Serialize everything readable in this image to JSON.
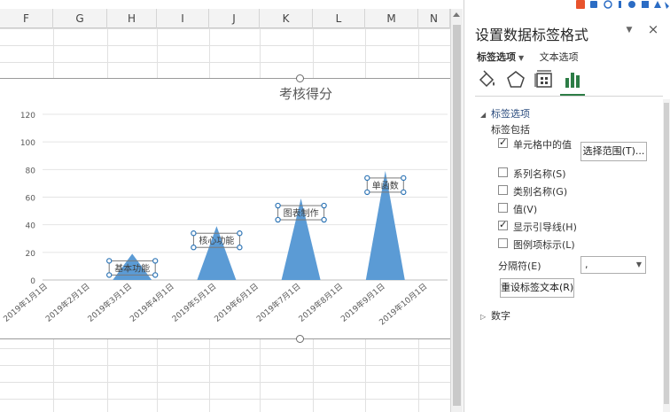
{
  "sheet": {
    "columns": [
      "F",
      "G",
      "H",
      "I",
      "J",
      "K",
      "L",
      "M",
      "N"
    ]
  },
  "chart": {
    "title": "考核得分"
  },
  "chart_data": {
    "type": "bar",
    "shape": "triangle",
    "title": "考核得分",
    "xlabel": "",
    "ylabel": "",
    "ylim": [
      0,
      120
    ],
    "yticks": [
      0,
      20,
      40,
      60,
      80,
      100,
      120
    ],
    "grid": true,
    "color": "#5b9bd5",
    "categories": [
      "2019年1月1日",
      "2019年2月1日",
      "2019年3月1日",
      "2019年4月1日",
      "2019年5月1日",
      "2019年6月1日",
      "2019年7月1日",
      "2019年8月1日",
      "2019年9月1日",
      "2019年10月1日"
    ],
    "points": [
      {
        "x": "2019年3月1日",
        "y": 19,
        "label": "基本功能"
      },
      {
        "x": "2019年5月1日",
        "y": 39,
        "label": "核心功能"
      },
      {
        "x": "2019年7月1日",
        "y": 59,
        "label": "图表制作"
      },
      {
        "x": "2019年9月1日",
        "y": 79,
        "label": "单函数"
      }
    ]
  },
  "pane": {
    "title": "设置数据标签格式",
    "tab_label_options": "标签选项",
    "tab_text_options": "文本选项",
    "section_label_options": "标签选项",
    "label_contains": "标签包括",
    "cb_value_from_cells": "单元格中的值",
    "btn_select_range": "选择范围(T)...",
    "cb_series_name": "系列名称(S)",
    "cb_category_name": "类别名称(G)",
    "cb_value": "值(V)",
    "cb_leader_lines": "显示引导线(H)",
    "cb_legend_key": "图例项标示(L)",
    "separator_label": "分隔符(E)",
    "separator_value": ",",
    "btn_reset_label_text": "重设标签文本(R)",
    "section_number": "数字",
    "checked": {
      "value_from_cells": true,
      "series_name": false,
      "category_name": false,
      "value": false,
      "leader_lines": true,
      "legend_key": false
    }
  }
}
